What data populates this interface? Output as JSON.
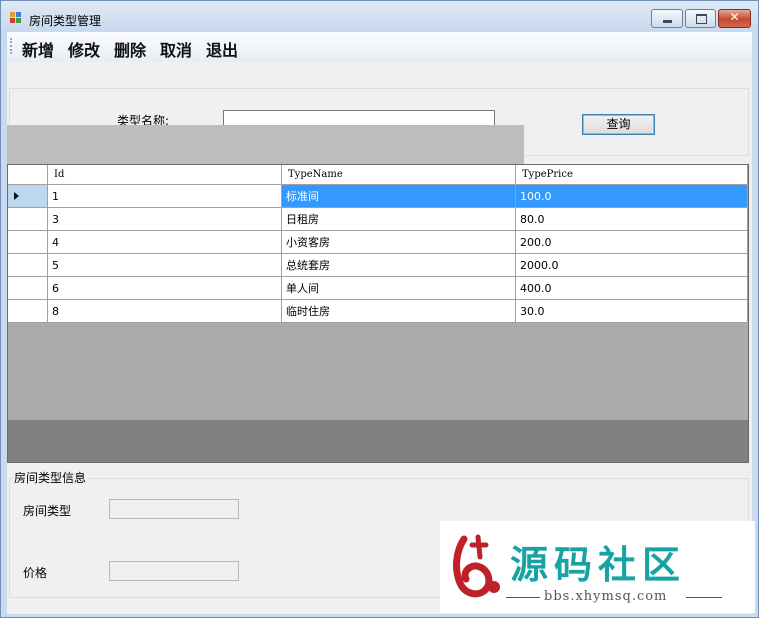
{
  "window": {
    "title": "房间类型管理",
    "controls": {
      "minimize_icon": "minimize-icon",
      "maximize_icon": "maximize-icon",
      "close_icon": "close-icon",
      "close_glyph": "✕"
    }
  },
  "toolbar": {
    "items": [
      "新增",
      "修改",
      "删除",
      "取消",
      "退出"
    ]
  },
  "search": {
    "label": "类型名称:",
    "value": "",
    "button": "查询"
  },
  "grid": {
    "columns": [
      "Id",
      "TypeName",
      "TypePrice"
    ],
    "rows": [
      [
        "1",
        "标准间",
        "100.0"
      ],
      [
        "3",
        "日租房",
        "80.0"
      ],
      [
        "4",
        "小资客房",
        "200.0"
      ],
      [
        "5",
        "总统套房",
        "2000.0"
      ],
      [
        "6",
        "单人间",
        "400.0"
      ],
      [
        "8",
        "临时住房",
        "30.0"
      ]
    ],
    "selected_row": 0
  },
  "info": {
    "legend": "房间类型信息",
    "room_type_label": "房间类型",
    "room_type_value": "",
    "price_label": "价格",
    "price_value": ""
  },
  "watermark": {
    "title": "源码社区",
    "url": "bbs.xhymsq.com"
  },
  "colors": {
    "selection": "#3399ff",
    "selected_row_header": "#bcd7f0",
    "grid_background": "#ababab",
    "accent": "#17a3a3"
  }
}
